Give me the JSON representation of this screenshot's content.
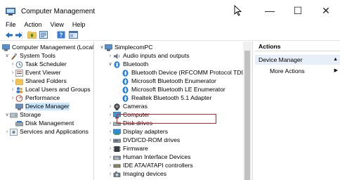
{
  "window": {
    "title": "Computer Management",
    "controls": {
      "minimize": "—",
      "maximize": "☐",
      "close": "✕"
    }
  },
  "menu": [
    "File",
    "Action",
    "View",
    "Help"
  ],
  "toolbar": {
    "icons": [
      "back-arrow-icon",
      "forward-arrow-icon",
      "up-folder-icon",
      "properties-icon",
      "help-icon",
      "console-icon"
    ]
  },
  "left_tree": [
    {
      "label": "Computer Management (Local)",
      "icon": "computer-management-icon",
      "arrow": ""
    },
    {
      "label": "System Tools",
      "icon": "tools-icon",
      "arrow": "∨"
    },
    {
      "label": "Task Scheduler",
      "icon": "clock-icon",
      "arrow": "›"
    },
    {
      "label": "Event Viewer",
      "icon": "event-viewer-icon",
      "arrow": "›"
    },
    {
      "label": "Shared Folders",
      "icon": "shared-folder-icon",
      "arrow": "›"
    },
    {
      "label": "Local Users and Groups",
      "icon": "users-icon",
      "arrow": "›"
    },
    {
      "label": "Performance",
      "icon": "performance-icon",
      "arrow": "›"
    },
    {
      "label": "Device Manager",
      "icon": "device-manager-icon",
      "arrow": ""
    },
    {
      "label": "Storage",
      "icon": "storage-icon",
      "arrow": "∨"
    },
    {
      "label": "Disk Management",
      "icon": "disk-management-icon",
      "arrow": ""
    },
    {
      "label": "Services and Applications",
      "icon": "services-icon",
      "arrow": "›"
    }
  ],
  "device_tree": [
    {
      "label": "SimplecomPC",
      "icon": "computer-icon",
      "arrow": "∨"
    },
    {
      "label": "Audio inputs and outputs",
      "icon": "audio-icon",
      "arrow": "›"
    },
    {
      "label": "Bluetooth",
      "icon": "bluetooth-icon",
      "arrow": "∨"
    },
    {
      "label": "Bluetooth Device (RFCOMM Protocol TDI)",
      "icon": "bluetooth-icon",
      "arrow": ""
    },
    {
      "label": "Microsoft Bluetooth Enumerator",
      "icon": "bluetooth-icon",
      "arrow": ""
    },
    {
      "label": "Microsoft Bluetooth LE Enumerator",
      "icon": "bluetooth-icon",
      "arrow": ""
    },
    {
      "label": "Realtek Bluetooth 5.1 Adapter",
      "icon": "bluetooth-icon",
      "arrow": ""
    },
    {
      "label": "Cameras",
      "icon": "camera-icon",
      "arrow": "›"
    },
    {
      "label": "Computer",
      "icon": "monitor-icon",
      "arrow": "›"
    },
    {
      "label": "Disk drives",
      "icon": "disk-drive-icon",
      "arrow": "›"
    },
    {
      "label": "Display adapters",
      "icon": "display-adapter-icon",
      "arrow": "›"
    },
    {
      "label": "DVD/CD-ROM drives",
      "icon": "dvd-icon",
      "arrow": "›"
    },
    {
      "label": "Firmware",
      "icon": "firmware-icon",
      "arrow": "›"
    },
    {
      "label": "Human Interface Devices",
      "icon": "hid-icon",
      "arrow": "›"
    },
    {
      "label": "IDE ATA/ATAPI controllers",
      "icon": "ide-icon",
      "arrow": "›"
    },
    {
      "label": "Imaging devices",
      "icon": "imaging-icon",
      "arrow": "›"
    }
  ],
  "actions": {
    "header": "Actions",
    "section": "Device Manager",
    "section_arrow": "▲",
    "more": "More Actions",
    "more_arrow": "▶"
  },
  "colors": {
    "highlight_border": "#d8202a",
    "selected_bg": "#cce8ff",
    "bluetooth_blue": "#1f7ae0"
  }
}
